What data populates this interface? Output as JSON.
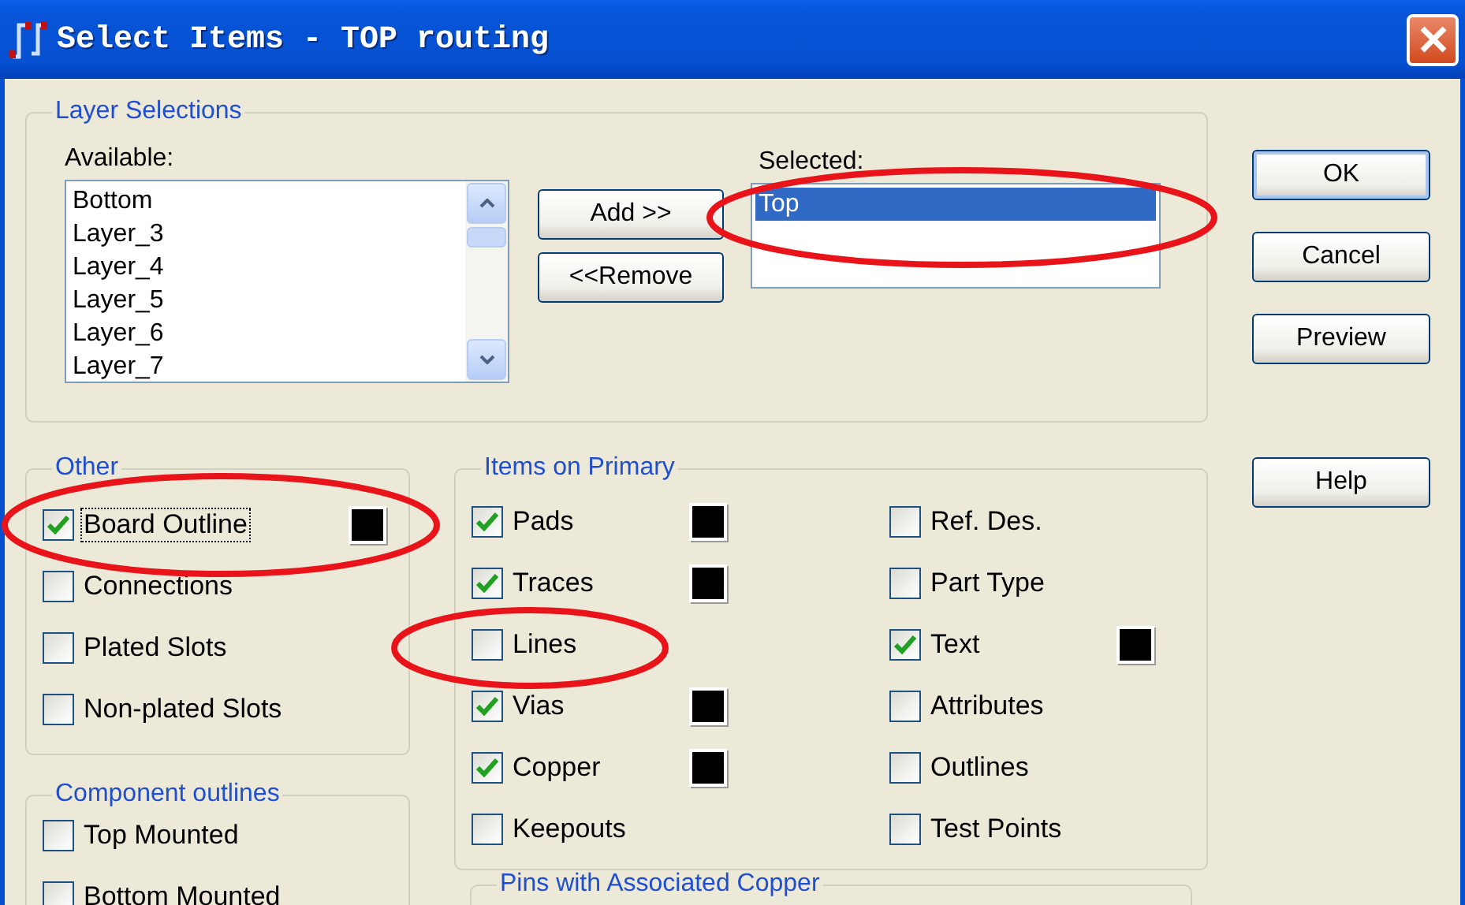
{
  "window": {
    "title": "Select Items - TOP routing"
  },
  "layer_selections": {
    "legend": "Layer Selections",
    "available_label": "Available:",
    "available": [
      {
        "label": "Bottom",
        "selected": false
      },
      {
        "label": "Layer_3",
        "selected": false
      },
      {
        "label": "Layer_4",
        "selected": false
      },
      {
        "label": "Layer_5",
        "selected": false
      },
      {
        "label": "Layer_6",
        "selected": false
      },
      {
        "label": "Layer_7",
        "selected": false
      }
    ],
    "add_button": "Add >>",
    "remove_button": "<<Remove",
    "selected_label": "Selected:",
    "selected_list": [
      {
        "label": "Top",
        "selected": true
      }
    ]
  },
  "buttons": [
    {
      "label": "OK",
      "default": true
    },
    {
      "label": "Cancel",
      "default": false
    },
    {
      "label": "Preview",
      "default": false
    },
    {
      "label": "Help",
      "default": false
    }
  ],
  "other": {
    "legend": "Other",
    "items": [
      {
        "label": "Board Outline",
        "checked": true,
        "focused": true,
        "color": "#000000"
      },
      {
        "label": "Connections",
        "checked": false,
        "focused": false
      },
      {
        "label": "Plated Slots",
        "checked": false,
        "focused": false
      },
      {
        "label": "Non-plated Slots",
        "checked": false,
        "focused": false
      }
    ]
  },
  "component_outlines": {
    "legend": "Component outlines",
    "items": [
      {
        "label": "Top Mounted",
        "checked": false
      },
      {
        "label": "Bottom Mounted",
        "checked": false
      }
    ]
  },
  "items_on_primary": {
    "legend": "Items on Primary",
    "columns": [
      [
        {
          "label": "Pads",
          "checked": true,
          "color": "#000000"
        },
        {
          "label": "Traces",
          "checked": true,
          "color": "#000000"
        },
        {
          "label": "Lines",
          "checked": false
        },
        {
          "label": "Vias",
          "checked": true,
          "color": "#000000"
        },
        {
          "label": "Copper",
          "checked": true,
          "color": "#000000"
        },
        {
          "label": "Keepouts",
          "checked": false
        }
      ],
      [
        {
          "label": "Ref. Des.",
          "checked": false
        },
        {
          "label": "Part Type",
          "checked": false
        },
        {
          "label": "Text",
          "checked": true,
          "color": "#000000"
        },
        {
          "label": "Attributes",
          "checked": false
        },
        {
          "label": "Outlines",
          "checked": false
        },
        {
          "label": "Test Points",
          "checked": false
        }
      ]
    ]
  },
  "pins_with_associated_copper": {
    "legend": "Pins with Associated Copper"
  }
}
